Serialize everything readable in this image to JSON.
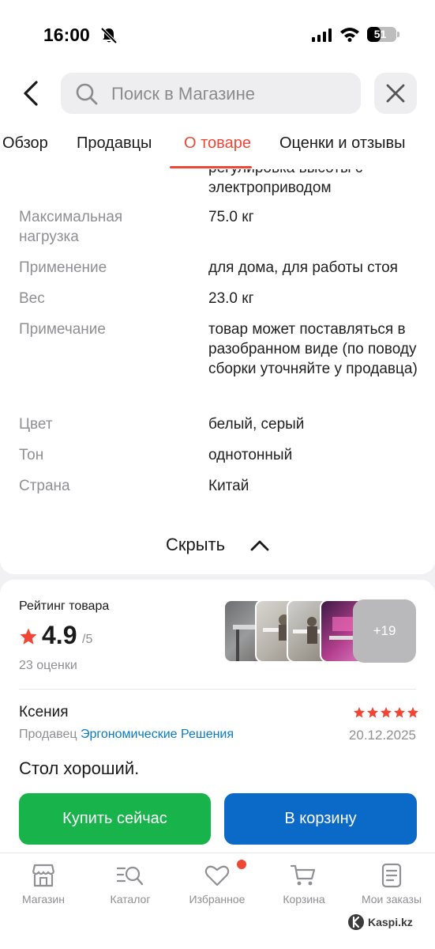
{
  "status_bar": {
    "time": "16:00",
    "battery": "51",
    "battery_level": 0.51
  },
  "search": {
    "placeholder": "Поиск в Магазине"
  },
  "tabs": [
    {
      "label": "Обзор",
      "active": false
    },
    {
      "label": "Продавцы",
      "active": false
    },
    {
      "label": "О товаре",
      "active": true
    },
    {
      "label": "Оценки и отзывы",
      "active": false
    }
  ],
  "specs": {
    "partial_top": [
      "регулировка высоты с",
      "электроприводом"
    ],
    "rows": [
      {
        "label": "Максимальная нагрузка",
        "value": "75.0 кг"
      },
      {
        "label": "Применение",
        "value": "для дома, для работы стоя"
      },
      {
        "label": "Вес",
        "value": "23.0 кг"
      },
      {
        "label": "Примечание",
        "value": "товар может поставляться в разобранном виде (по поводу сборки уточняйте у продавца)"
      },
      {
        "label": "Цвет",
        "value": "белый, серый"
      },
      {
        "label": "Тон",
        "value": "однотонный"
      },
      {
        "label": "Страна",
        "value": "Китай"
      }
    ],
    "hide_label": "Скрыть"
  },
  "rating": {
    "title": "Рейтинг товара",
    "value": "4.9",
    "max": "/5",
    "count": "23 оценки",
    "more_photos": "+19",
    "stars": 5
  },
  "review": {
    "author": "Ксения",
    "seller_prefix": "Продавец",
    "seller_name": "Эргономические Решения",
    "date": "20.12.2025",
    "text": "Стол хороший."
  },
  "actions": {
    "buy": "Купить сейчас",
    "cart": "В корзину"
  },
  "nav": [
    {
      "label": "Магазин",
      "icon": "store-icon"
    },
    {
      "label": "Каталог",
      "icon": "catalog-search-icon"
    },
    {
      "label": "Избранное",
      "icon": "heart-icon"
    },
    {
      "label": "Корзина",
      "icon": "cart-icon"
    },
    {
      "label": "Мои заказы",
      "icon": "orders-icon"
    }
  ],
  "watermark": "Kaspi.kz",
  "colors": {
    "accent": "#f14635",
    "buy": "#19b34b",
    "cart": "#0b69c7",
    "link": "#0b7bc1"
  }
}
